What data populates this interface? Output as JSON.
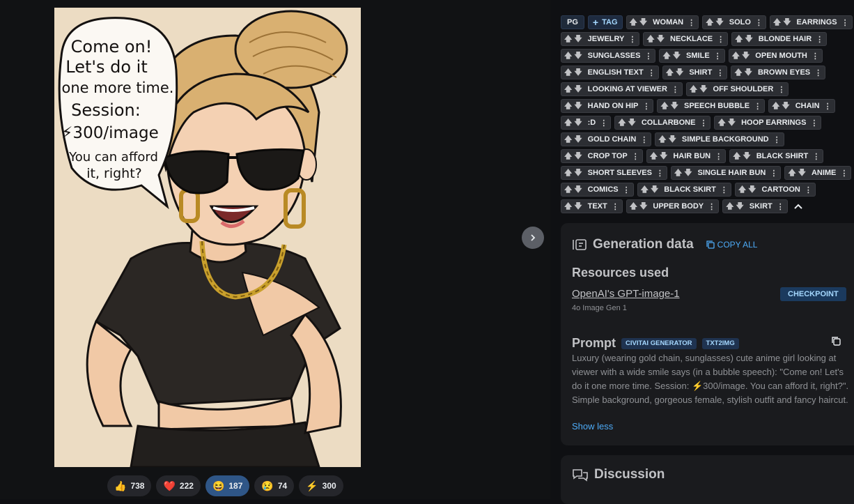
{
  "artwork": {
    "bubble_lines": [
      "Come on!",
      "Let's do it",
      "one more time.",
      "Session:",
      "⚡300/image",
      "You can afford",
      "it, right?"
    ]
  },
  "reactions": [
    {
      "icon": "👍",
      "name": "like-reaction",
      "count": "738",
      "active": false
    },
    {
      "icon": "❤️",
      "name": "heart-reaction",
      "count": "222",
      "active": false
    },
    {
      "icon": "😆",
      "name": "laugh-reaction",
      "count": "187",
      "active": true
    },
    {
      "icon": "😢",
      "name": "cry-reaction",
      "count": "74",
      "active": false
    },
    {
      "icon": "⚡",
      "name": "buzz-tip",
      "count": "300",
      "active": false
    }
  ],
  "rating_label": "PG",
  "add_tag_label": "TAG",
  "tags": [
    "WOMAN",
    "SOLO",
    "EARRINGS",
    "JEWELRY",
    "NECKLACE",
    "BLONDE HAIR",
    "SUNGLASSES",
    "SMILE",
    "OPEN MOUTH",
    "ENGLISH TEXT",
    "SHIRT",
    "BROWN EYES",
    "LOOKING AT VIEWER",
    "OFF SHOULDER",
    "HAND ON HIP",
    "SPEECH BUBBLE",
    "CHAIN",
    ":D",
    "COLLARBONE",
    "HOOP EARRINGS",
    "GOLD CHAIN",
    "SIMPLE BACKGROUND",
    "CROP TOP",
    "HAIR BUN",
    "BLACK SHIRT",
    "SHORT SLEEVES",
    "SINGLE HAIR BUN",
    "ANIME",
    "COMICS",
    "BLACK SKIRT",
    "CARTOON",
    "TEXT",
    "UPPER BODY",
    "SKIRT"
  ],
  "generation": {
    "title": "Generation data",
    "copy_all": "COPY ALL",
    "resources_heading": "Resources used",
    "resource_name": "OpenAI's GPT-image-1",
    "resource_version": "4o Image Gen 1",
    "resource_type": "CHECKPOINT",
    "prompt_heading": "Prompt",
    "prompt_badges": [
      "CIVITAI GENERATOR",
      "TXT2IMG"
    ],
    "prompt_text": "Luxury (wearing gold chain, sunglasses) cute anime girl looking at viewer with a wide smile says (in a bubble speech): \"Come on! Let's do it one more time. Session: ⚡300/image. You can afford it, right?\". Simple background, gorgeous female, stylish outfit and fancy haircut.",
    "show_less": "Show less"
  },
  "discussion": {
    "title": "Discussion"
  },
  "colors": {
    "accent": "#4dabf7",
    "card_bg": "#1a1b1e",
    "page_bg": "#0f1013",
    "tag_bg": "#2c2e33"
  }
}
